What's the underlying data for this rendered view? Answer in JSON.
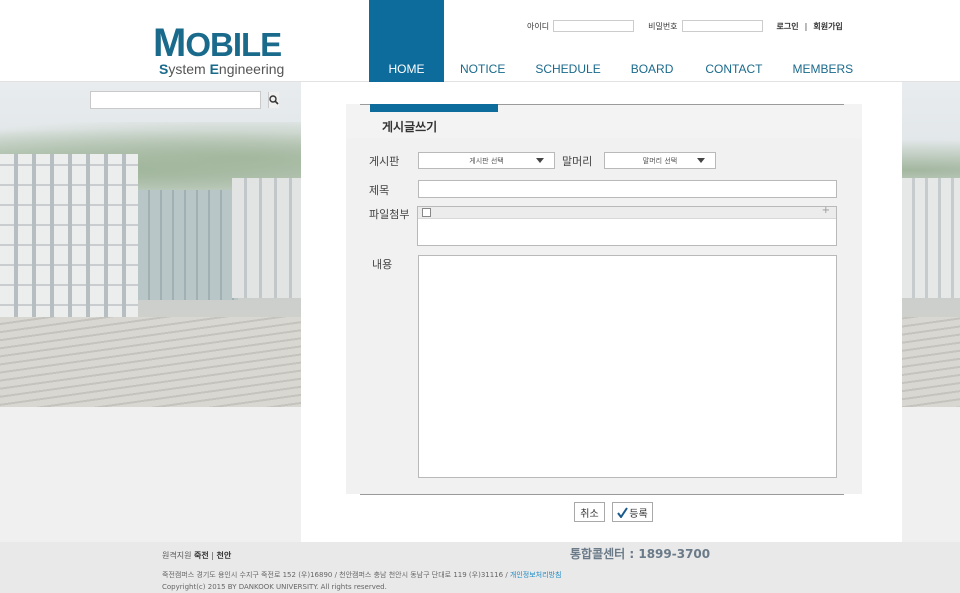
{
  "header": {
    "logo_main": "OBILE",
    "logo_initial": "M",
    "logo_sub_initial": "S",
    "logo_sub_rest": "ystem ",
    "logo_sub_e": "E",
    "logo_sub_end": "ngineering",
    "nav": [
      "HOME",
      "NOTICE",
      "SCHEDULE",
      "BOARD",
      "CONTACT",
      "MEMBERS"
    ],
    "active_nav": "HOME",
    "login": {
      "id_label": "아이디",
      "pw_label": "비밀번호",
      "login_button": "로그인",
      "separator": "|",
      "signup_button": "회원가입"
    }
  },
  "search": {
    "placeholder": ""
  },
  "form": {
    "title": "게시글쓰기",
    "board_label": "게시판",
    "board_select": "게시판 선택",
    "prefix_label": "말머리",
    "prefix_select": "말머리 선택",
    "subject_label": "제목",
    "attach_label": "파일첨부",
    "attach_plus": "+",
    "content_label": "내용",
    "cancel_button": "취소",
    "submit_button": "등록"
  },
  "footer": {
    "campus_label": "원격지원",
    "campus_jukjeon": "죽전",
    "campus_sep": "|",
    "campus_cheonan": "천안",
    "callcenter": "통합콜센터 : 1899-3700",
    "address": "죽전캠퍼스 경기도 용인시 수지구 죽전로 152 (우)16890 / 천안캠퍼스 충남 천안시 동남구 단대로 119 (우)31116 /",
    "privacy_link": "개인정보처리방침",
    "copyright": "Copyright(c) 2015 BY DANKOOK UNIVERSITY. All rights reserved."
  },
  "colors": {
    "brand": "#0e6c9c",
    "logo": "#1a6a8c"
  }
}
